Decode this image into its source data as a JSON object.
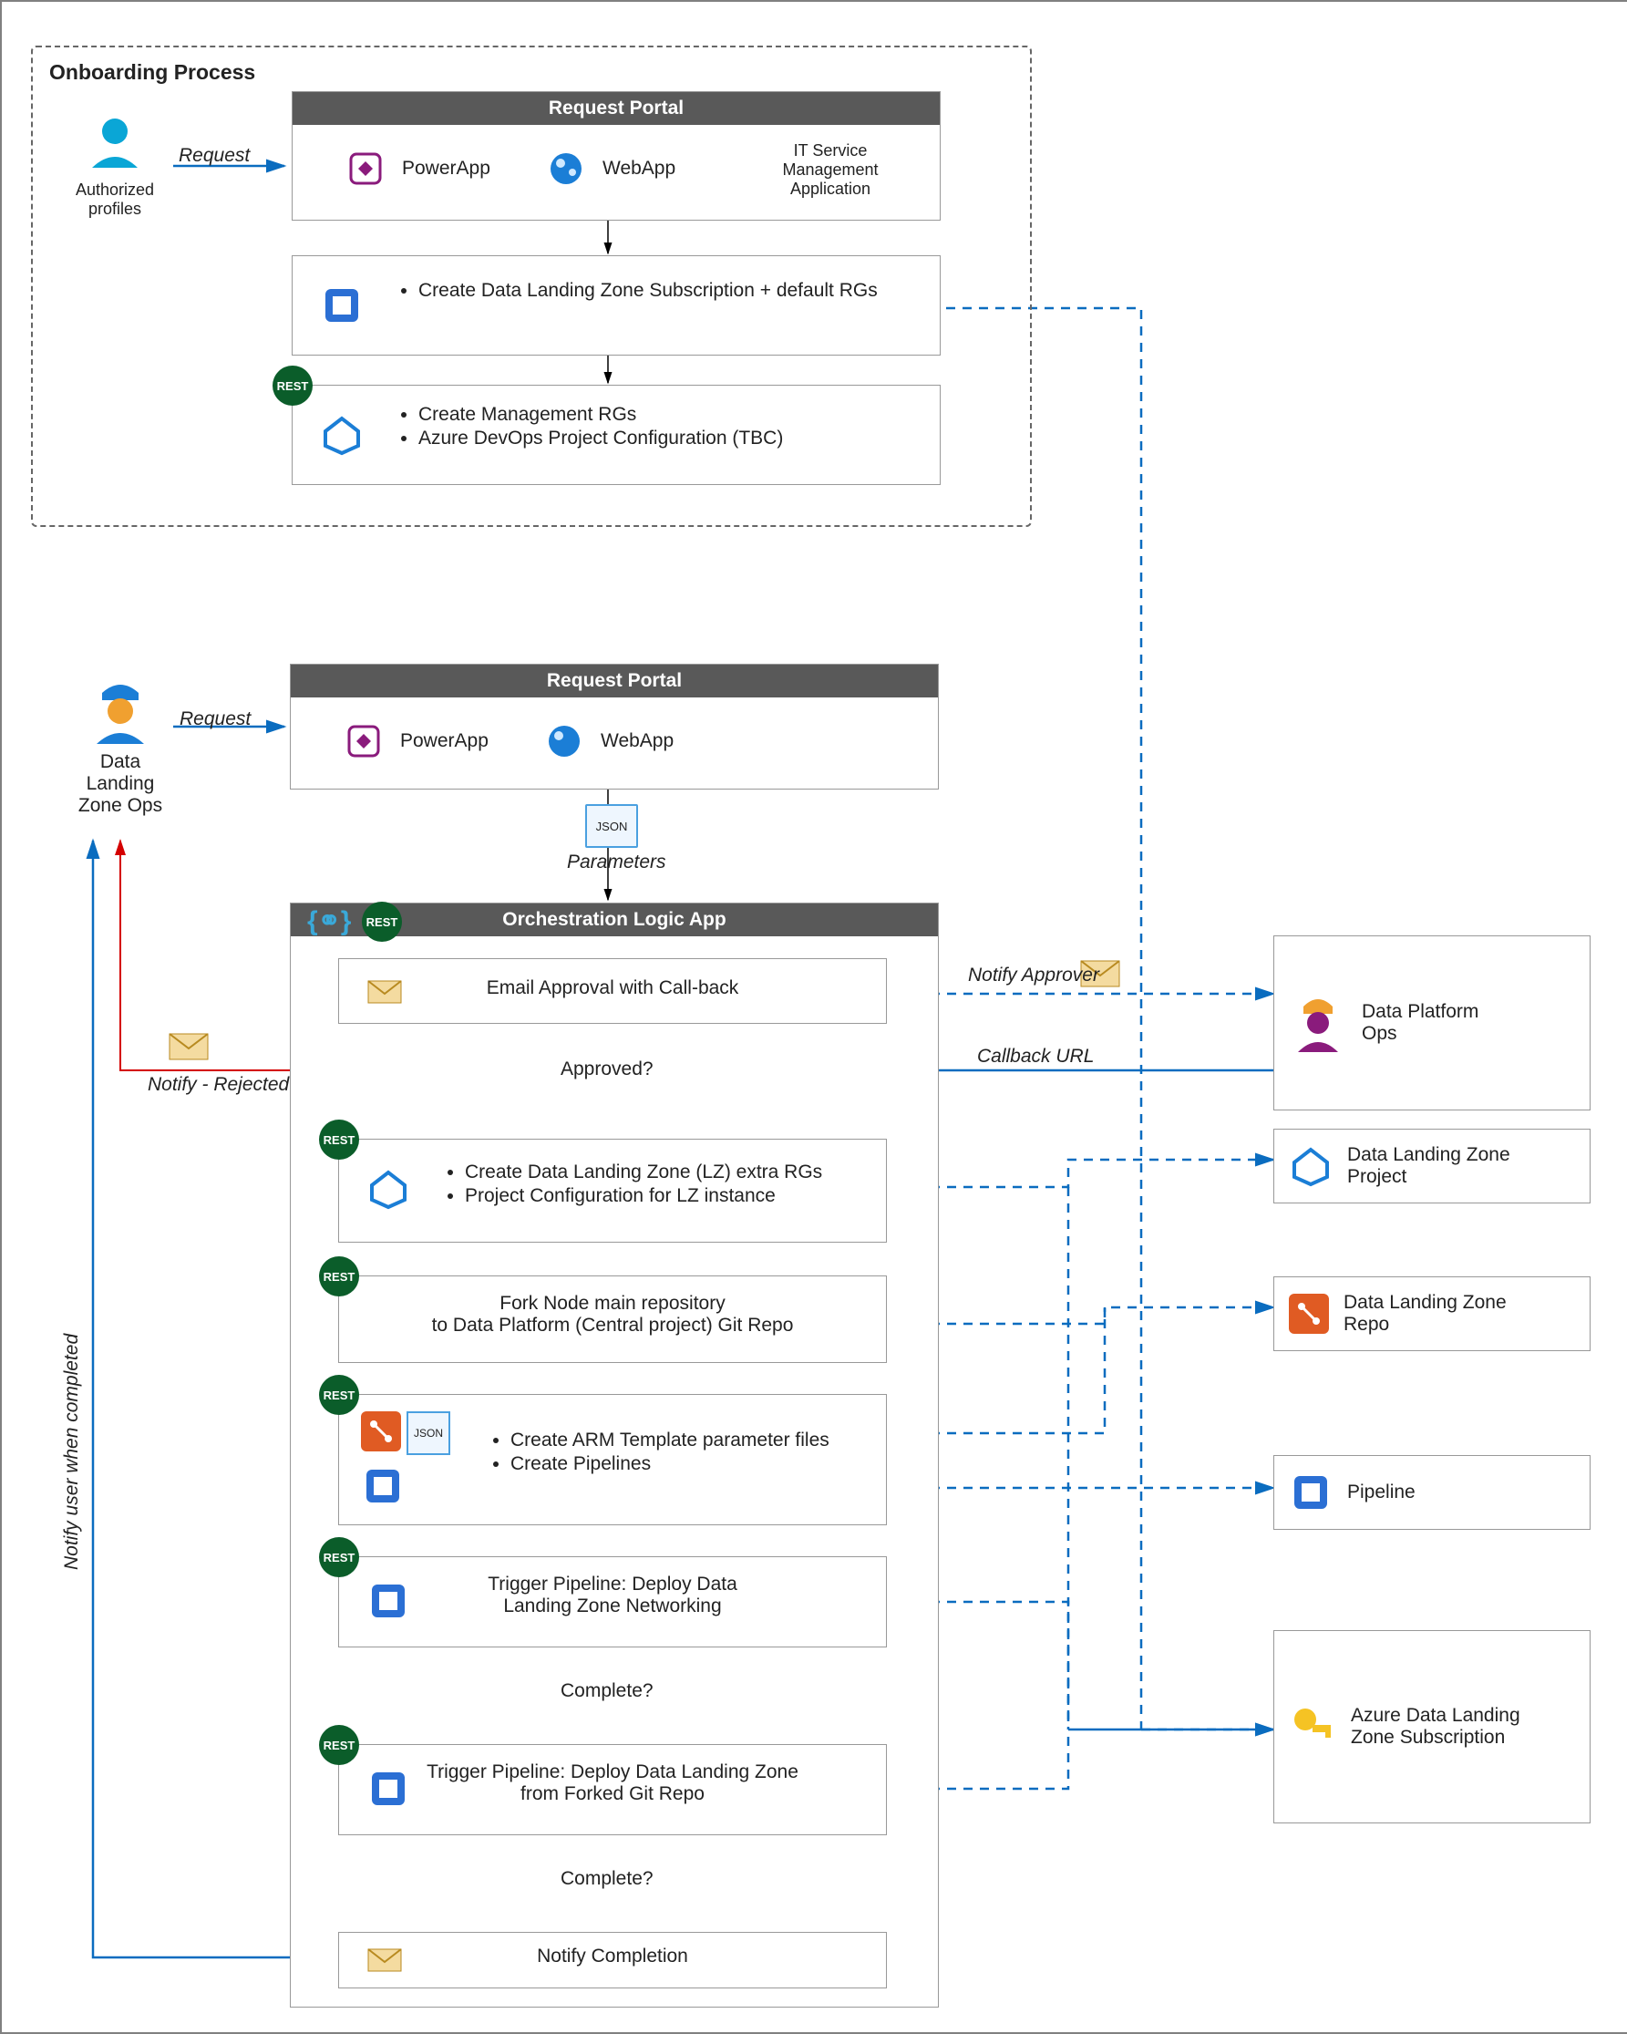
{
  "onboarding": {
    "title": "Onboarding Process",
    "actor": "Authorized profiles",
    "request_label": "Request",
    "portal_title": "Request Portal",
    "powerapp": "PowerApp",
    "webapp": "WebApp",
    "itsm": "IT Service Management Application",
    "task1_items": [
      "Create Data Landing Zone Subscription + default RGs"
    ],
    "task2_items": [
      "Create Management RGs",
      "Azure DevOps Project Configuration (TBC)"
    ],
    "rest": "REST"
  },
  "main": {
    "actor_line1": "Data",
    "actor_line2": "Landing",
    "actor_line3": "Zone Ops",
    "request_label": "Request",
    "portal_title": "Request Portal",
    "powerapp": "PowerApp",
    "webapp": "WebApp",
    "json_label": "JSON",
    "parameters_label": "Parameters",
    "orchestration_title": "Orchestration Logic App",
    "rest": "REST",
    "email_approval": "Email Approval with Call-back",
    "approved_q": "Approved?",
    "notify_rejected": "Notify - Rejected",
    "notify_approver": "Notify Approver",
    "callback_url": "Callback URL",
    "step_rgs": [
      "Create Data Landing Zone (LZ) extra RGs",
      "Project Configuration for LZ instance"
    ],
    "step_fork_line1": "Fork Node main repository",
    "step_fork_line2": "to Data Platform (Central project) Git Repo",
    "step_arm": [
      "Create ARM Template parameter files",
      "Create Pipelines"
    ],
    "json_label2": "JSON",
    "step_trigger1_line1": "Trigger Pipeline: Deploy Data",
    "step_trigger1_line2": "Landing Zone Networking",
    "complete_q": "Complete?",
    "step_trigger2_line1": "Trigger Pipeline: Deploy Data Landing Zone",
    "step_trigger2_line2": "from Forked Git Repo",
    "notify_completion": "Notify Completion",
    "notify_user_complete": "Notify user when completed"
  },
  "right": {
    "data_platform_ops": "Data Platform Ops",
    "dlz_project": "Data Landing Zone Project",
    "dlz_repo": "Data Landing Zone Repo",
    "pipeline": "Pipeline",
    "azure_sub": "Azure Data Landing Zone Subscription"
  }
}
